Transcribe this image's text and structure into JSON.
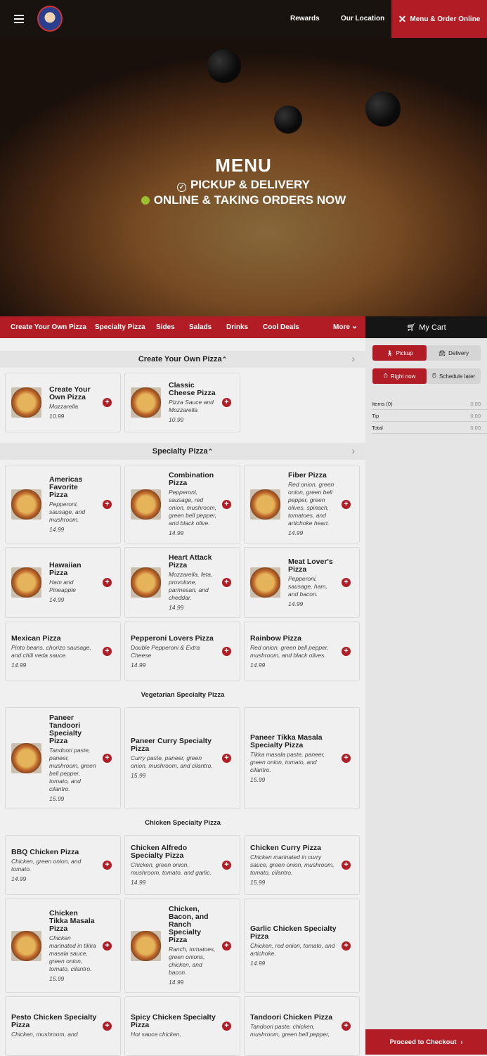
{
  "header": {
    "rewards": "Rewards",
    "location": "Our Location",
    "order": "Menu & Order Online"
  },
  "hero": {
    "title": "MENU",
    "line1": "PICKUP & DELIVERY",
    "line2": "ONLINE & TAKING ORDERS NOW"
  },
  "nav": {
    "items": [
      "Create Your Own Pizza",
      "Specialty Pizza",
      "Sides",
      "Salads",
      "Drinks",
      "Cool Deals"
    ],
    "more": "More"
  },
  "cart": {
    "title": "My Cart",
    "pickup": "Pickup",
    "delivery": "Delivery",
    "right_now": "Right now",
    "schedule": "Schedule later",
    "rows": [
      {
        "label": "Items (0)",
        "value": "0.00"
      },
      {
        "label": "Tip",
        "value": "0.00"
      },
      {
        "label": "Total",
        "value": "0.00"
      }
    ],
    "checkout": "Proceed to Checkout"
  },
  "sections": [
    {
      "type": "cat",
      "title": "Create Your Own Pizza",
      "items": [
        {
          "name": "Create Your Own Pizza",
          "desc": "Mozzarella",
          "price": "10.99",
          "img": true
        },
        {
          "name": "Classic Cheese Pizza",
          "desc": "Pizza Sauce and Mozzarella",
          "price": "10.99",
          "img": true
        }
      ]
    },
    {
      "type": "cat",
      "title": "Specialty Pizza",
      "items": [
        {
          "name": "Americas Favorite Pizza",
          "desc": "Pepperoni, sausage, and mushroom.",
          "price": "14.99",
          "img": true
        },
        {
          "name": "Combination Pizza",
          "desc": "Pepperoni, sausage, red onion, mushroom, green bell pepper, and black olive.",
          "price": "14.99",
          "img": true
        },
        {
          "name": "Fiber Pizza",
          "desc": "Red onion, green onion, green bell pepper, green olives, spinach, tomatoes, and artichoke heart.",
          "price": "14.99",
          "img": true
        },
        {
          "name": "Hawaiian Pizza",
          "desc": "Ham and Pineapple",
          "price": "14.99",
          "img": true
        },
        {
          "name": "Heart Attack Pizza",
          "desc": "Mozzarella, feta, provolone, parmesan, and cheddar.",
          "price": "14.99",
          "img": true
        },
        {
          "name": "Meat Lover's Pizza",
          "desc": "Pepperoni, sausage, ham, and bacon.",
          "price": "14.99",
          "img": true
        },
        {
          "name": "Mexican Pizza",
          "desc": "Pinto beans, chorizo sausage, and chili veda sauce.",
          "price": "14.99",
          "img": false
        },
        {
          "name": "Pepperoni Lovers Pizza",
          "desc": "Double Pepperoni & Extra Cheese",
          "price": "14.99",
          "img": false
        },
        {
          "name": "Rainbow Pizza",
          "desc": "Red onion, green bell pepper, mushroom, and black olives.",
          "price": "14.99",
          "img": false
        }
      ]
    },
    {
      "type": "sub",
      "title": "Vegetarian Specialty Pizza",
      "items": [
        {
          "name": "Paneer Tandoori Specialty Pizza",
          "desc": "Tandoori paste, paneer, mushroom, green bell pepper, tomato, and cilantro.",
          "price": "15.99",
          "img": true
        },
        {
          "name": "Paneer Curry Specialty Pizza",
          "desc": "Curry paste, paneer, green onion, mushroom, and cilantro.",
          "price": "15.99",
          "img": false
        },
        {
          "name": "Paneer Tikka Masala Specialty Pizza",
          "desc": "Tikka masala paste, paneer, green onion, tomato, and cilantro.",
          "price": "15.99",
          "img": false
        }
      ]
    },
    {
      "type": "sub",
      "title": "Chicken Specialty Pizza",
      "items": [
        {
          "name": "BBQ Chicken Pizza",
          "desc": "Chicken, green onion, and tomato.",
          "price": "14.99",
          "img": false
        },
        {
          "name": "Chicken Alfredo Specialty Pizza",
          "desc": "Chicken, green onion, mushroom, tomato, and garlic.",
          "price": "14.99",
          "img": false
        },
        {
          "name": "Chicken Curry Pizza",
          "desc": "Chicken marinated in curry sauce, green onion, mushroom, tomato, cilantro.",
          "price": "15.99",
          "img": false
        },
        {
          "name": "Chicken Tikka Masala Pizza",
          "desc": "Chicken marinated in tikka masala sauce, green onion, tomato, cilantro.",
          "price": "15.99",
          "img": true
        },
        {
          "name": "Chicken, Bacon, and Ranch Specialty Pizza",
          "desc": "Ranch, tomatoes, green onions, chicken, and bacon.",
          "price": "14.99",
          "img": true
        },
        {
          "name": "Garlic Chicken Specialty Pizza",
          "desc": "Chicken, red onion, tomato, and artichoke.",
          "price": "14.99",
          "img": false
        },
        {
          "name": "Pesto Chicken Specialty Pizza",
          "desc": "Chicken, mushroom, and",
          "price": "",
          "img": false
        },
        {
          "name": "Spicy Chicken Specialty Pizza",
          "desc": "Hot sauce chicken,",
          "price": "",
          "img": false
        },
        {
          "name": "Tandoori Chicken Pizza",
          "desc": "Tandoori paste, chicken, mushroom, green bell pepper,",
          "price": "",
          "img": false
        }
      ]
    }
  ]
}
